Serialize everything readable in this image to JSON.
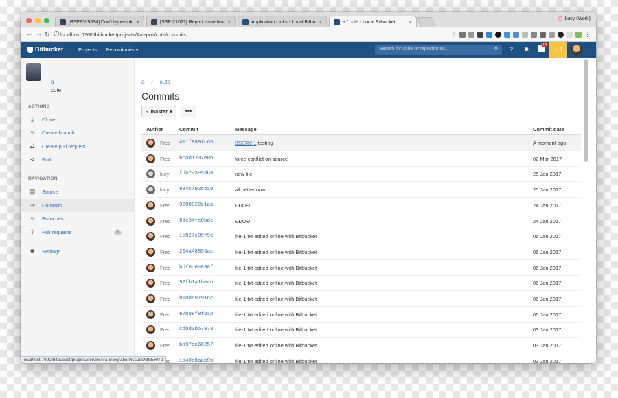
{
  "browser": {
    "tabs": [
      {
        "title": "[BSERV-9634] Don't hyperlink",
        "close": "×",
        "icon": "jira-icon"
      },
      {
        "title": "[SSP-21027] Report issue link",
        "close": "×",
        "icon": "jira-icon"
      },
      {
        "title": "Application Links - Local Bitbu",
        "close": "×",
        "icon": "bitbucket-icon"
      },
      {
        "title": "a / cute - Local Bitbucket",
        "close": "×",
        "icon": "bitbucket-icon"
      }
    ],
    "profile": "Lucy (Work)",
    "url": "localhost:7990/bitbucket/projects/A/repos/cute/commits",
    "status_url": "localhost:7990/bitbucket/plugins/servlet/jira-integration/issues/BSERV-1"
  },
  "header": {
    "brand": "Bitbucket",
    "nav": [
      "Projects",
      "Repositories ▾"
    ],
    "search_placeholder": "Search for code or repositories...",
    "notification_count": "13",
    "warning_count": "1"
  },
  "sidebar": {
    "project": "a",
    "repo": "cute",
    "actions_title": "ACTIONS",
    "actions": [
      {
        "label": "Clone",
        "icon": "clone-icon"
      },
      {
        "label": "Create branch",
        "icon": "branch-icon"
      },
      {
        "label": "Create pull request",
        "icon": "pull-request-icon"
      },
      {
        "label": "Fork",
        "icon": "fork-icon"
      }
    ],
    "navigation_title": "NAVIGATION",
    "navigation": [
      {
        "label": "Source",
        "icon": "source-icon"
      },
      {
        "label": "Commits",
        "icon": "commits-icon"
      },
      {
        "label": "Branches",
        "icon": "branches-icon"
      },
      {
        "label": "Pull requests",
        "icon": "pull-requests-icon",
        "badge": "1"
      }
    ],
    "settings": "Settings",
    "collapse": "«"
  },
  "main": {
    "breadcrumb": [
      "a",
      "/",
      "cute"
    ],
    "title": "Commits",
    "branch": "master",
    "more": "•••",
    "columns": [
      "Author",
      "Commit",
      "Message",
      "Commit date"
    ],
    "rows": [
      {
        "author": "Fred",
        "hash": "411f889fc65",
        "issue": "BSERV-1",
        "message": " testing",
        "date": "A moment ago"
      },
      {
        "author": "Fred",
        "hash": "bcad1207e0b",
        "message": "force conflict on source",
        "date": "02 Mar 2017"
      },
      {
        "author": "lucy",
        "hash": "fdb7a3e55b8",
        "message": "new file",
        "date": "25 Jan 2017"
      },
      {
        "author": "lucy",
        "hash": "984c792cb19",
        "message": "all better now",
        "date": "25 Jan 2017"
      },
      {
        "author": "Fred",
        "hash": "9288822c1aa",
        "message": "ÐÐÒÐ",
        "date": "24 Jan 2017"
      },
      {
        "author": "Fred",
        "hash": "8de34fc0bdc",
        "message": "ÐÐÒÐ",
        "date": "24 Jan 2017"
      },
      {
        "author": "Fred",
        "hash": "1e827c09f9c",
        "message": "file-1.txt edited online with Bitbucket",
        "date": "06 Jan 2017"
      },
      {
        "author": "Fred",
        "hash": "204a48855ac",
        "message": "file-1.txt edited online with Bitbucket",
        "date": "06 Jan 2017"
      },
      {
        "author": "Fred",
        "hash": "bdf0c6e898f",
        "message": "file-1.txt edited online with Bitbucket",
        "date": "06 Jan 2017"
      },
      {
        "author": "Fred",
        "hash": "92fb1a1beab",
        "message": "file-1.txt edited online with Bitbucket",
        "date": "06 Jan 2017"
      },
      {
        "author": "Fred",
        "hash": "b18d60791cc",
        "message": "file-1.txt edited online with Bitbucket",
        "date": "06 Jan 2017"
      },
      {
        "author": "Fred",
        "hash": "e7b98f8f818",
        "message": "file-1.txt edited online with Bitbucket",
        "date": "06 Jan 2017"
      },
      {
        "author": "Fred",
        "hash": "cdbd0b57973",
        "message": "file-1.txt edited online with Bitbucket",
        "date": "03 Jan 2017"
      },
      {
        "author": "Fred",
        "hash": "ba97dc68257",
        "message": "file-1.txt edited online with Bitbucket",
        "date": "03 Jan 2017"
      },
      {
        "author": "Fred",
        "hash": "1b40c8aab9b",
        "message": "file-1.txt edited online with Bitbucket",
        "date": "03 Jan 2017"
      }
    ]
  },
  "colors": {
    "header": "#205081",
    "link": "#3572b0",
    "warning": "#f6c342"
  }
}
